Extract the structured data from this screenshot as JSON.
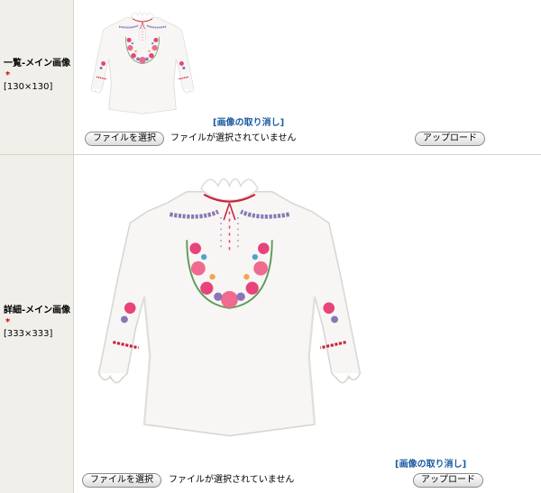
{
  "rows": [
    {
      "label": "一覧-メイン画像",
      "required_mark": "*",
      "size": "[130×130]",
      "image": "white-embroidered-blouse",
      "cancel_link": "[画像の取り消し]",
      "file_button": "ファイルを選択",
      "file_status": "ファイルが選択されていません",
      "upload_button": "アップロード"
    },
    {
      "label": "詳細-メイン画像",
      "required_mark": "*",
      "size": "[333×333]",
      "image": "white-embroidered-blouse",
      "cancel_link": "[画像の取り消し]",
      "file_button": "ファイルを選択",
      "file_status": "ファイルが選択されていません",
      "upload_button": "アップロード"
    }
  ],
  "colors": {
    "header_bg": "#f0efea",
    "border": "#d6d3cb",
    "required": "#d20000",
    "link": "#1a5aa0"
  }
}
